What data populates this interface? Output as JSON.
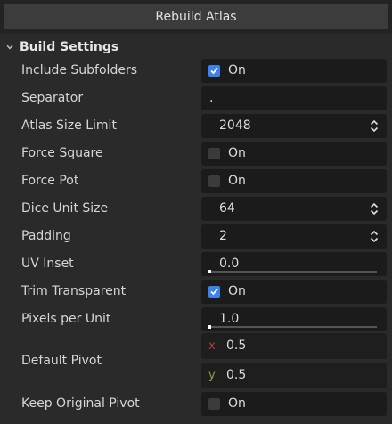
{
  "toolbar": {
    "rebuild_label": "Rebuild Atlas",
    "icon": "play-icon"
  },
  "section": {
    "title": "Build Settings",
    "expanded": true
  },
  "fields": {
    "include_subfolders": {
      "label": "Include Subfolders",
      "checked": true,
      "text": "On"
    },
    "separator": {
      "label": "Separator",
      "value": "."
    },
    "atlas_size_limit": {
      "label": "Atlas Size Limit",
      "value": "2048"
    },
    "force_square": {
      "label": "Force Square",
      "checked": false,
      "text": "On"
    },
    "force_pot": {
      "label": "Force Pot",
      "checked": false,
      "text": "On"
    },
    "dice_unit_size": {
      "label": "Dice Unit Size",
      "value": "64"
    },
    "padding": {
      "label": "Padding",
      "value": "2"
    },
    "uv_inset": {
      "label": "UV Inset",
      "value": "0.0",
      "fraction": 0.0
    },
    "trim_transparent": {
      "label": "Trim Transparent",
      "checked": true,
      "text": "On"
    },
    "pixels_per_unit": {
      "label": "Pixels per Unit",
      "value": "1.0",
      "fraction": 0.0
    },
    "default_pivot": {
      "label": "Default Pivot",
      "x_label": "x",
      "x": "0.5",
      "y_label": "y",
      "y": "0.5"
    },
    "keep_original_pivot": {
      "label": "Keep Original Pivot",
      "checked": false,
      "text": "On"
    }
  },
  "colors": {
    "accent": "#3d82e8",
    "play": "#56c23a",
    "x_axis": "#b34040",
    "y_axis": "#8fa043"
  }
}
